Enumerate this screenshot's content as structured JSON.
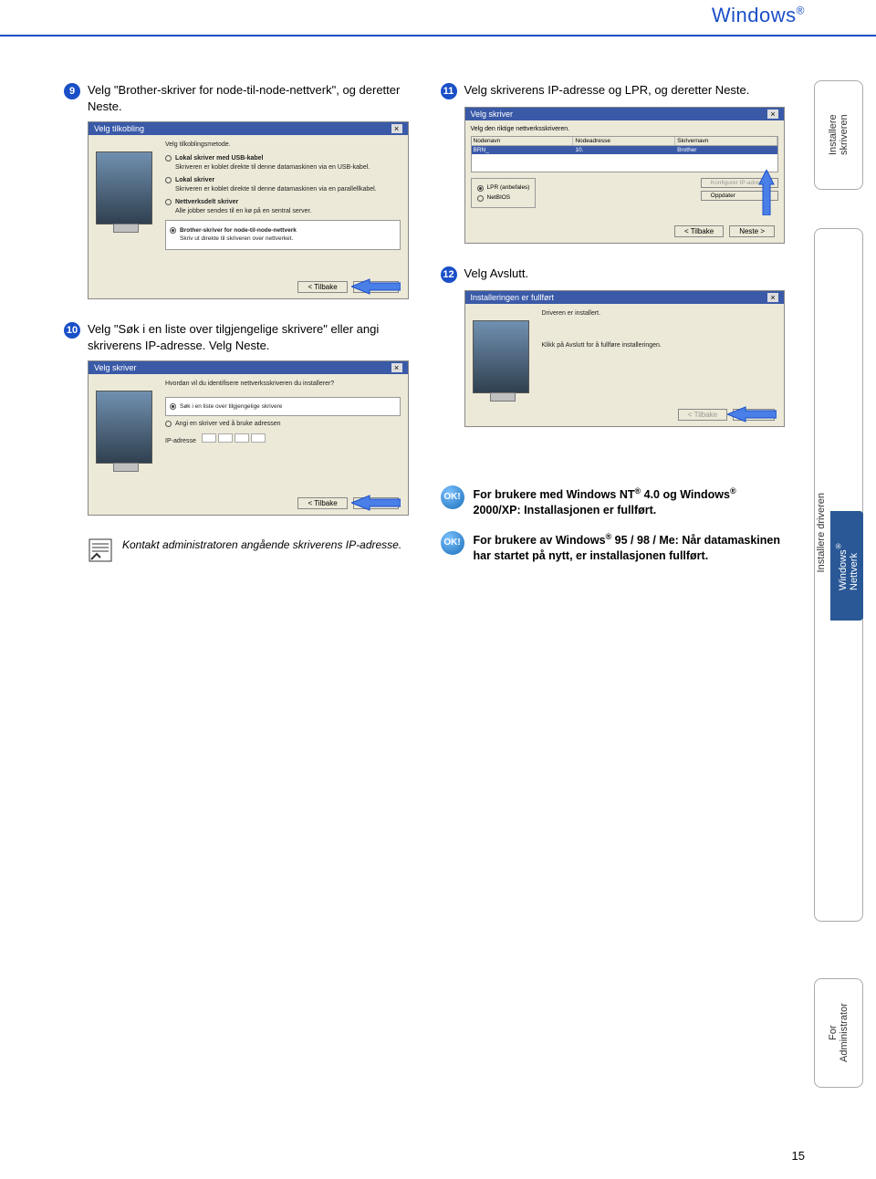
{
  "header": {
    "title": "Windows",
    "reg": "®"
  },
  "steps": {
    "s9": {
      "num": "9",
      "text": "Velg \"Brother-skriver for node-til-node-nettverk\", og deretter Neste."
    },
    "s10": {
      "num": "10",
      "text": "Velg \"Søk i en liste over tilgjengelige skrivere\" eller angi skriverens IP-adresse. Velg Neste."
    },
    "s11": {
      "num": "11",
      "text": "Velg skriverens IP-adresse og LPR, og deretter Neste."
    },
    "s12": {
      "num": "12",
      "text": "Velg Avslutt."
    }
  },
  "note": {
    "text": "Kontakt administratoren angående skriverens IP-adresse."
  },
  "ok1": {
    "prefix": "For brukere med Windows NT",
    "sup1": "®",
    "mid": " 4.0 og Windows",
    "sup2": "®",
    "suffix": " 2000/XP: Installasjonen er fullført."
  },
  "ok2": {
    "prefix": "For brukere av Windows",
    "sup1": "®",
    "suffix": " 95 / 98 / Me: Når datamaskinen har startet på nytt, er installasjonen fullført."
  },
  "ok_label": "OK!",
  "tabs": {
    "t1a": "Installere",
    "t1b": "skriveren",
    "t2": "Installere driveren",
    "t2inner_a": "Windows",
    "t2inner_b": "Nettverk",
    "t2inner_sup": "®",
    "t3a": "For",
    "t3b": "Administrator"
  },
  "page_number": "15",
  "ss9": {
    "title": "Velg tilkobling",
    "heading": "Velg tilkoblingsmetode.",
    "opt1": "Lokal skriver med USB-kabel",
    "opt1sub": "Skriveren er koblet direkte til denne datamaskinen via en USB-kabel.",
    "opt2": "Lokal skriver",
    "opt2sub": "Skriveren er koblet direkte til denne datamaskinen via en parallellkabel.",
    "opt3": "Nettverksdelt skriver",
    "opt3sub": "Alle jobber sendes til en kø på en sentral server.",
    "opt4": "Brother-skriver for node-til-node-nettverk",
    "opt4sub": "Skriv ut direkte til skriveren over nettverket.",
    "back": "< Tilbake",
    "next": "Neste >"
  },
  "ss10": {
    "title": "Velg skriver",
    "heading": "Hvordan vil du identifisere nettverksskriveren du installerer?",
    "opt1": "Søk i en liste over tilgjengelige skrivere",
    "opt2": "Angi en skriver ved å bruke adressen",
    "iplabel": "IP-adresse",
    "back": "< Tilbake",
    "next": "Neste >"
  },
  "ss11": {
    "title": "Velg skriver",
    "heading": "Velg den riktige nettverksskriveren.",
    "col1": "Nodenavn",
    "col2": "Nodeadresse",
    "col3": "Skrivernavn",
    "row1": "BRN_",
    "row2": "10.",
    "row3": "Brother",
    "lpr": "LPR (anbefales)",
    "netbios": "NetBIOS",
    "cfg": "Konfigurer IP-adresse",
    "upd": "Oppdater",
    "back": "< Tilbake",
    "next": "Neste >"
  },
  "ss12": {
    "title": "Installeringen er fullført",
    "heading": "Driveren er installert.",
    "body": "Klikk på Avslutt for å fullføre installeringen.",
    "back": "< Tilbake",
    "finish": "Avslutt"
  }
}
